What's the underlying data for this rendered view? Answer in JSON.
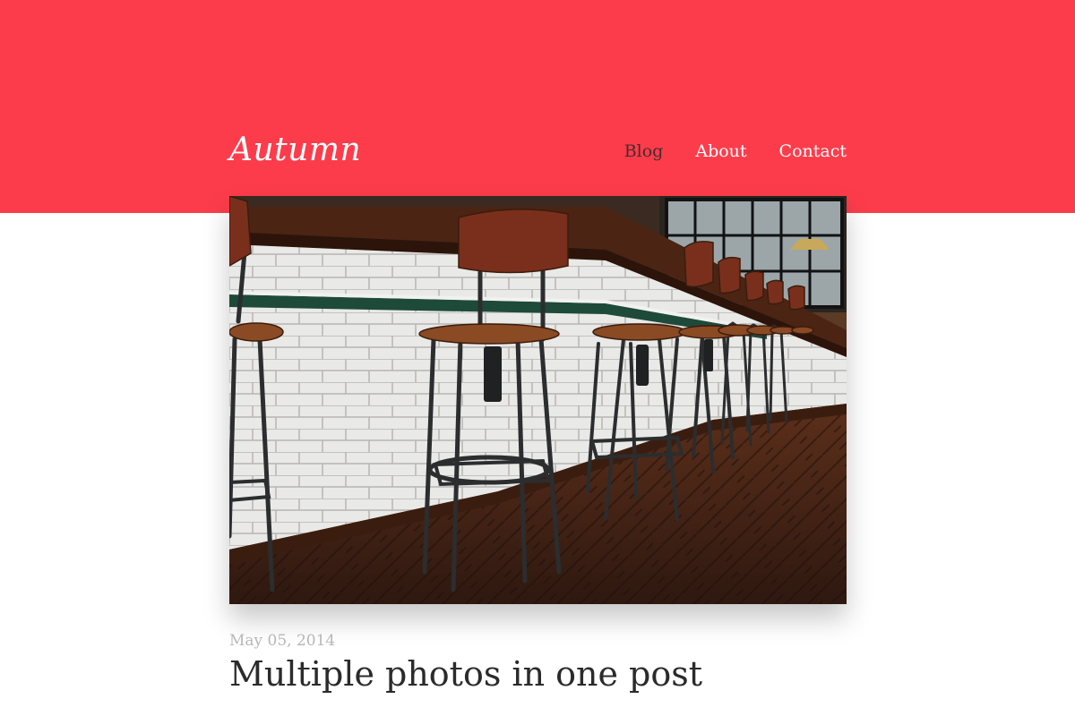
{
  "site": {
    "title": "Autumn"
  },
  "nav": {
    "items": [
      {
        "label": "Blog",
        "active": true
      },
      {
        "label": "About"
      },
      {
        "label": "Contact"
      }
    ]
  },
  "colors": {
    "accent": "#fd3c4b",
    "active_nav": "#4a2a2e"
  },
  "post": {
    "date": "May 05, 2014",
    "title": "Multiple photos in one post",
    "hero_image": "photo of a bar counter with white subway tiles and metal bar stools with wooden seats on a herringbone wood floor"
  }
}
